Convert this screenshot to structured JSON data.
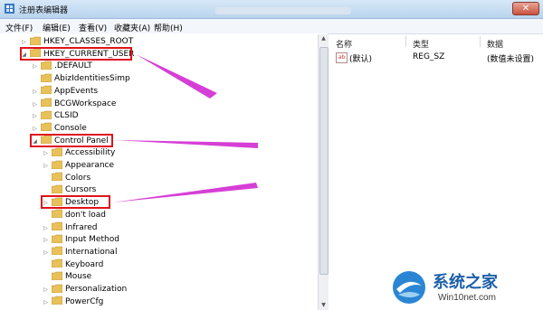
{
  "window": {
    "title": "注册表编辑器",
    "close_glyph": "✕"
  },
  "menu": [
    "文件(F)",
    "编辑(E)",
    "查看(V)",
    "收藏夹(A)",
    "帮助(H)"
  ],
  "tree": [
    {
      "label": "HKEY_CLASSES_ROOT",
      "expander": "▷"
    },
    {
      "label": "HKEY_CURRENT_USER",
      "expander": "◢"
    },
    {
      "label": ".DEFAULT",
      "expander": "▷"
    },
    {
      "label": "AbizIdentitiesSimp",
      "expander": ""
    },
    {
      "label": "AppEvents",
      "expander": "▷"
    },
    {
      "label": "BCGWorkspace",
      "expander": "▷"
    },
    {
      "label": "CLSID",
      "expander": "▷"
    },
    {
      "label": "Console",
      "expander": "▷"
    },
    {
      "label": "Control Panel",
      "expander": "◢"
    },
    {
      "label": "Accessibility",
      "expander": "▷"
    },
    {
      "label": "Appearance",
      "expander": "▷"
    },
    {
      "label": "Colors",
      "expander": ""
    },
    {
      "label": "Cursors",
      "expander": ""
    },
    {
      "label": "Desktop",
      "expander": "▷"
    },
    {
      "label": "don't load",
      "expander": ""
    },
    {
      "label": "Infrared",
      "expander": "▷"
    },
    {
      "label": "Input Method",
      "expander": "▷"
    },
    {
      "label": "International",
      "expander": "▷"
    },
    {
      "label": "Keyboard",
      "expander": ""
    },
    {
      "label": "Mouse",
      "expander": ""
    },
    {
      "label": "Personalization",
      "expander": "▷"
    },
    {
      "label": "PowerCfg",
      "expander": "▷"
    }
  ],
  "list": {
    "headers": [
      "名称",
      "类型",
      "数据"
    ],
    "rows": [
      {
        "icon": "ab",
        "name": "(默认)",
        "type": "REG_SZ",
        "data": "(数值未设置)"
      }
    ]
  },
  "watermark": {
    "brand": "系统之家",
    "site": "Win10net.com"
  },
  "colors": {
    "highlight_box": "#e0121b",
    "arrow": "#d63fd6",
    "folder": "#e8c15a"
  }
}
